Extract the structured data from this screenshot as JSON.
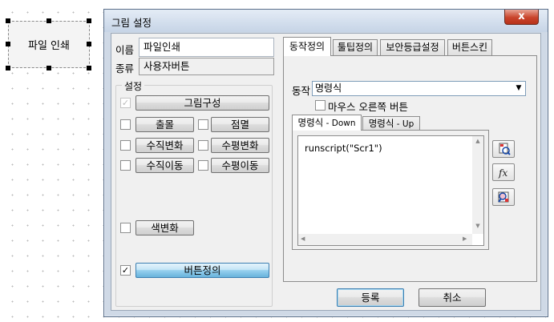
{
  "canvas": {
    "shape_label": "파일 인쇄"
  },
  "dialog": {
    "title": "그림 설정",
    "close_glyph": "x",
    "name_label": "이름",
    "name_value": "파일인쇄",
    "type_label": "종류",
    "type_value": "사용자버튼",
    "settings_group_label": "설정",
    "settings": {
      "compose": {
        "label": "그림구성",
        "checked": true,
        "enabled": false
      },
      "blink": {
        "label": "출몰",
        "checked": false
      },
      "flash": {
        "label": "점멸",
        "checked": false
      },
      "vscale": {
        "label": "수직변화",
        "checked": false
      },
      "hscale": {
        "label": "수평변화",
        "checked": false
      },
      "vmove": {
        "label": "수직이동",
        "checked": false
      },
      "hmove": {
        "label": "수평이동",
        "checked": false
      },
      "color": {
        "label": "색변화",
        "checked": false
      },
      "button": {
        "label": "버튼정의",
        "checked": true
      }
    },
    "tabs": [
      "동작정의",
      "툴팁정의",
      "보안등급설정",
      "버튼스킨"
    ],
    "action": {
      "label": "동작",
      "selected": "명령식",
      "right_click_label": "마우스 오른쪽 버튼",
      "right_click_checked": false,
      "subtabs": [
        {
          "main": "명령식",
          "suffix": " - Down"
        },
        {
          "main": "명령식",
          "suffix": " - Up"
        }
      ],
      "script": "runscript(\"Scr1\")"
    },
    "side_icons": [
      "script-edit-icon",
      "function-icon",
      "find-object-icon"
    ],
    "ok_label": "등록",
    "cancel_label": "취소"
  }
}
